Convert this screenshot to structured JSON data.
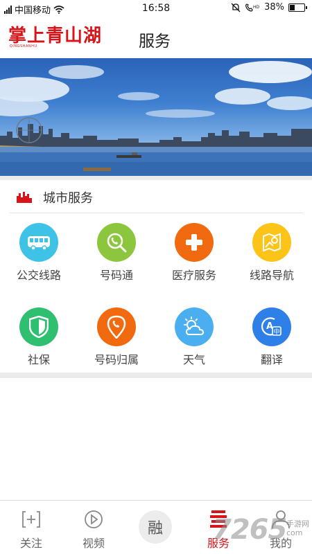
{
  "status_bar": {
    "carrier": "中国移动",
    "time": "16:58",
    "battery": "38%",
    "battery_level": 0.38
  },
  "header": {
    "logo_text": "掌上青山湖",
    "logo_subtext": "QINGSHANHU",
    "title": "服务"
  },
  "section": {
    "title": "城市服务"
  },
  "services": [
    {
      "label": "公交线路",
      "icon": "bus-icon",
      "color": "#3ec2e6"
    },
    {
      "label": "号码通",
      "icon": "phone-search-icon",
      "color": "#8cc63f"
    },
    {
      "label": "医疗服务",
      "icon": "medical-cross-icon",
      "color": "#f26a10"
    },
    {
      "label": "线路导航",
      "icon": "map-navigation-icon",
      "color": "#fcc419"
    },
    {
      "label": "社保",
      "icon": "shield-icon",
      "color": "#2fbf71"
    },
    {
      "label": "号码归属",
      "icon": "phone-location-icon",
      "color": "#f26a10"
    },
    {
      "label": "天气",
      "icon": "weather-icon",
      "color": "#4aaef0"
    },
    {
      "label": "翻译",
      "icon": "translate-icon",
      "color": "#2f7fe8"
    }
  ],
  "nav": {
    "items": [
      {
        "label": "关注",
        "icon": "follow-icon"
      },
      {
        "label": "视频",
        "icon": "video-play-icon"
      },
      {
        "label": "融",
        "icon": "fusion-icon"
      },
      {
        "label": "服务",
        "icon": "service-icon"
      },
      {
        "label": "我的",
        "icon": "profile-icon"
      }
    ],
    "active": "服务"
  },
  "watermark": {
    "text": "7265",
    "sub1": "手游网",
    "sub2": "com"
  },
  "colors": {
    "brand_red": "#d7141a"
  }
}
